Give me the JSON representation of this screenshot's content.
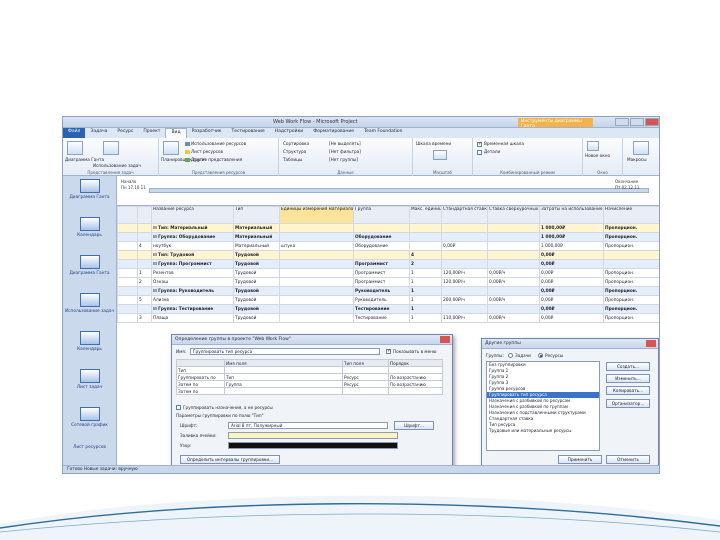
{
  "window": {
    "title": "Web Work Flow - Microsoft Project",
    "context_tab": "Инструменты диаграммы Ганта"
  },
  "tabs": [
    "Файл",
    "Задача",
    "Ресурс",
    "Проект",
    "Вид",
    "Разработчик",
    "Тестирование",
    "Надстройки",
    "Форматирование",
    "Team Foundation"
  ],
  "ribbon": {
    "groups": [
      "Представления задач",
      "Представления ресурсов",
      "Данные",
      "Масштаб",
      "Комбинированный режим",
      "Окно"
    ],
    "buttons": {
      "gantt": "Диаграмма Ганта",
      "task_usage": "Использование задач",
      "team_planner": "Планировщик групп",
      "resource_usage": "Использование ресурсов",
      "other_views": "Другие представления",
      "sort": "Сортировка",
      "outline": "Структура",
      "tables": "Таблицы",
      "highlight": "[Не выделять]",
      "filter": "[Нет фильтра]",
      "group": "[Нет группы]",
      "timescale": "Шкала времени",
      "timeline_check": "Временная шкала",
      "details_check": "Детали",
      "new_window": "Новое окно",
      "macros": "Макросы"
    }
  },
  "sidebar": [
    "Диаграмма Ганта",
    "Календарь",
    "Диаграмма Ганта",
    "Использование задач",
    "Календарь",
    "Лист задач",
    "Сетевой график",
    "Лист ресурсов",
    "Задачи"
  ],
  "timeline": {
    "start_label": "Начало",
    "start_date": "Пн 17.10.11",
    "end_label": "Окончание",
    "end_date": "Пт 02.12.11"
  },
  "grid": {
    "headers": [
      "",
      "",
      "Название ресурса",
      "Тип",
      "Единицы измерения материалов",
      "Группа",
      "Макс. единиц",
      "Стандартная ставка",
      "Ставка сверхурочных",
      "Затраты на использование",
      "Начисление"
    ],
    "rows": [
      {
        "style": "g1",
        "cells": [
          "",
          "",
          "⊟ Тип: Материальный",
          "Материальный",
          "",
          "",
          "",
          "",
          "",
          "1 000,00₽",
          "Пропорцион."
        ]
      },
      {
        "style": "g2",
        "cells": [
          "",
          "",
          "⊟ Группа: Оборудование",
          "Материальный",
          "",
          "Оборудование",
          "",
          "",
          "",
          "1 000,00₽",
          "Пропорцион."
        ]
      },
      {
        "style": "",
        "cells": [
          "",
          "4",
          "ноутбук",
          "Материальный",
          "штука",
          "Оборудование",
          "",
          "0,00₽",
          "",
          "1 000,00₽",
          "Пропорцион."
        ]
      },
      {
        "style": "g1",
        "cells": [
          "",
          "",
          "⊟ Тип: Трудовой",
          "Трудовой",
          "",
          "",
          "4",
          "",
          "",
          "0,00₽",
          ""
        ]
      },
      {
        "style": "g2",
        "cells": [
          "",
          "",
          "⊟ Группа: Программист",
          "Трудовой",
          "",
          "Программист",
          "2",
          "",
          "",
          "0,00₽",
          ""
        ]
      },
      {
        "style": "",
        "cells": [
          "",
          "1",
          "Резентов",
          "Трудовой",
          "",
          "Программист",
          "1",
          "120,00₽/ч",
          "0,00₽/ч",
          "0,00₽",
          "Пропорцион."
        ]
      },
      {
        "style": "",
        "cells": [
          "",
          "2",
          "Ознаш",
          "Трудовой",
          "",
          "Программист",
          "1",
          "120,00₽/ч",
          "0,00₽/ч",
          "0,00₽",
          "Пропорцион."
        ]
      },
      {
        "style": "g2",
        "cells": [
          "",
          "",
          "⊟ Группа: Руководитель",
          "Трудовой",
          "",
          "Руководитель",
          "1",
          "",
          "",
          "0,00₽",
          "Пропорцион."
        ]
      },
      {
        "style": "",
        "cells": [
          "",
          "5",
          "Ализев",
          "Трудовой",
          "",
          "Руководитель",
          "1",
          "200,00₽/ч",
          "0,00₽/ч",
          "0,00₽",
          "Пропорцион."
        ]
      },
      {
        "style": "g2",
        "cells": [
          "",
          "",
          "⊟ Группа: Тестирование",
          "Трудовой",
          "",
          "Тестирование",
          "1",
          "",
          "",
          "0,00₽",
          "Пропорцион."
        ]
      },
      {
        "style": "",
        "cells": [
          "",
          "3",
          "Плаща",
          "Трудовой",
          "",
          "Тестирование",
          "1",
          "110,00₽/ч",
          "0,00₽/ч",
          "0,00₽",
          "Пропорцион."
        ]
      }
    ]
  },
  "status": "Готово    Новые задачи: вручную",
  "group_def_dialog": {
    "title": "Определение группы в проекте \"Web Work Flow\"",
    "name_label": "Имя:",
    "name_value": "Группировать тип ресурса",
    "show_menu": "Показывать в меню",
    "cols": [
      "",
      "Имя поля",
      "Тип поля",
      "Порядок"
    ],
    "rows": [
      [
        "Тип",
        "",
        "",
        ""
      ],
      [
        "Группировать по",
        "Тип",
        "Ресурс",
        "По возрастанию"
      ],
      [
        "Затем по",
        "Группа",
        "Ресурс",
        "По возрастанию"
      ],
      [
        "Затем по",
        "",
        "",
        ""
      ]
    ],
    "assign_check": "Группировать назначения, а не ресурсы",
    "settings_label": "Параметры группировки по полю \"Тип\"",
    "font_label": "Шрифт:",
    "font_value": "Arial 8 пт, Полужирный",
    "font_button": "Шрифт...",
    "cell_bg_label": "Заливка ячейки:",
    "pattern_label": "Узор:",
    "define_intervals": "Определить интервалы группировки...",
    "show_summary": "Показать суммарные задачи",
    "hierarchy": "Сохранять иерархию в текущем плане",
    "ok": "ОК",
    "cancel": "Отмена",
    "help": "Справка"
  },
  "more_groups_dialog": {
    "title": "Другие группы",
    "radio_tasks": "Задачи",
    "radio_resources": "Ресурсы",
    "items": [
      "Без группировки",
      "Группа 1",
      "Группа 2",
      "Группа 3",
      "Группа ресурсов",
      "Группировать тип ресурса",
      "Назначения с разбивкой по ресурсам",
      "Назначения с разбивкой по группам",
      "Назначения с подставленными структурами",
      "Стандартная ставка",
      "Тип ресурса",
      "Трудовые или материальные ресурсы"
    ],
    "selected_index": 5,
    "new": "Создать...",
    "edit": "Изменить...",
    "copy": "Копировать...",
    "organizer": "Организатор...",
    "apply": "Применить",
    "cancel": "Отменить"
  },
  "colors": {
    "accent": "#2a63b4",
    "context_tab": "#f6b24a",
    "highlight_col": "#fbe39b",
    "selection": "#3b73c6",
    "slide_deco": "#2c6e9c"
  }
}
